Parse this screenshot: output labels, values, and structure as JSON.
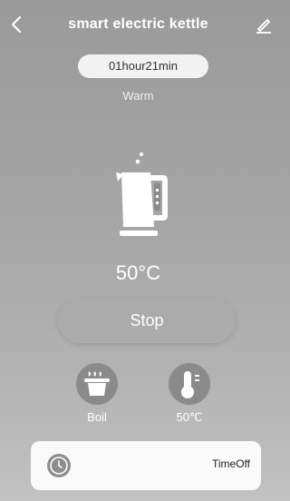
{
  "header": {
    "title": "smart electric kettle"
  },
  "status": {
    "timer": "01hour21min",
    "mode": "Warm"
  },
  "main": {
    "temperature": "50°C",
    "stop_label": "Stop"
  },
  "controls": {
    "boil_label": "Boil",
    "temp_label": "50℃"
  },
  "timer_card": {
    "label": "TimeOff"
  },
  "icons": {
    "back": "chevron-left-icon",
    "edit": "edit-icon",
    "kettle": "kettle-icon",
    "boil": "pot-icon",
    "temp": "thermometer-icon",
    "clock": "clock-icon"
  }
}
